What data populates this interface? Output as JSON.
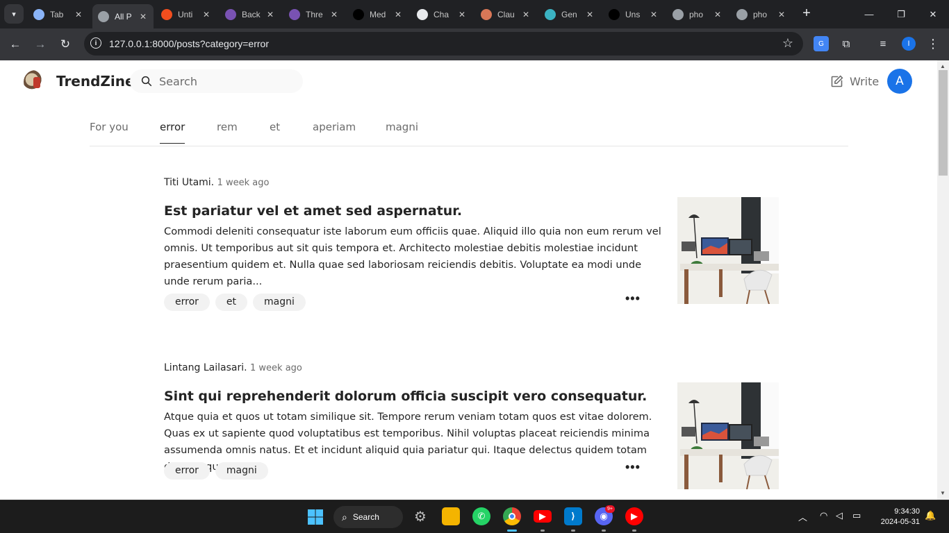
{
  "browser": {
    "tabs": [
      {
        "title": "Tab",
        "icon": "chrome-icon",
        "color": "#8ab4f8"
      },
      {
        "title": "All P",
        "icon": "globe-icon",
        "color": "#9aa0a6"
      },
      {
        "title": "Unti",
        "icon": "figma-icon",
        "color": "#f24e1e"
      },
      {
        "title": "Back",
        "icon": "bootstrap-icon",
        "color": "#7952b3"
      },
      {
        "title": "Thre",
        "icon": "bootstrap-icon",
        "color": "#7952b3"
      },
      {
        "title": "Med",
        "icon": "medium-icon",
        "color": "#000000"
      },
      {
        "title": "Cha",
        "icon": "chatgpt-icon",
        "color": "#e8eaed"
      },
      {
        "title": "Clau",
        "icon": "claude-icon",
        "color": "#d97757"
      },
      {
        "title": "Gen",
        "icon": "grid-icon",
        "color": "#3bb3c3"
      },
      {
        "title": "Uns",
        "icon": "unsplash-icon",
        "color": "#000000"
      },
      {
        "title": "pho",
        "icon": "globe-icon",
        "color": "#9aa0a6"
      },
      {
        "title": "pho",
        "icon": "globe-icon",
        "color": "#9aa0a6"
      }
    ],
    "active_tab": 1,
    "url": "127.0.0.1:8000/posts?category=error",
    "profile_initial": "I"
  },
  "site": {
    "brand": "TrendZine",
    "search_placeholder": "Search",
    "write_label": "Write",
    "avatar_initial": "A"
  },
  "categories": [
    {
      "label": "For you",
      "active": false
    },
    {
      "label": "error",
      "active": true
    },
    {
      "label": "rem",
      "active": false
    },
    {
      "label": "et",
      "active": false
    },
    {
      "label": "aperiam",
      "active": false
    },
    {
      "label": "magni",
      "active": false
    }
  ],
  "posts": [
    {
      "author": "Titi Utami.",
      "ago": "1 week ago",
      "title": "Est pariatur vel et amet sed aspernatur.",
      "body": "Commodi deleniti consequatur iste laborum eum officiis quae. Aliquid illo quia non eum rerum vel omnis. Ut temporibus aut sit quis tempora et. Architecto molestiae debitis molestiae incidunt praesentium quidem et. Nulla quae sed laboriosam reiciendis debitis. Voluptate ea modi unde unde rerum paria...",
      "tags": [
        "error",
        "et",
        "magni"
      ],
      "more": "•••"
    },
    {
      "author": "Lintang Lailasari.",
      "ago": "1 week ago",
      "title": "Sint qui reprehenderit dolorum officia suscipit vero consequatur.",
      "body": "Atque quia et quos ut totam similique sit. Tempore rerum veniam totam quos est vitae dolorem. Quas ex ut sapiente quod voluptatibus est temporibus. Nihil voluptas placeat reiciendis minima assumenda omnis natus. Et et incidunt aliquid quia pariatur qui. Itaque delectus quidem totam doloremque unde....",
      "tags": [
        "error",
        "magni"
      ],
      "more": "•••"
    }
  ],
  "taskbar": {
    "search_label": "Search",
    "discord_badge": "9+",
    "time": "9:34:30",
    "date": "2024-05-31"
  }
}
